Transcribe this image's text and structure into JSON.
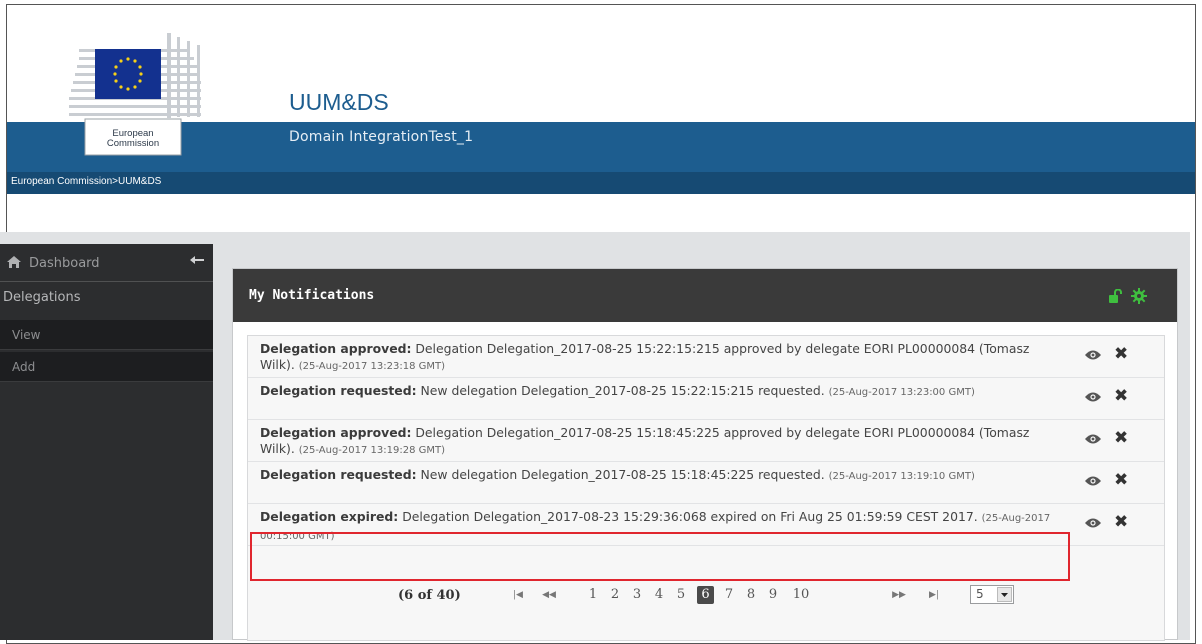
{
  "header": {
    "logo_text_line1": "European",
    "logo_text_line2": "Commission",
    "app_title": "UUM&DS",
    "domain": "Domain IntegrationTest_1"
  },
  "breadcrumb": {
    "items": [
      "European Commission",
      "UUM&DS"
    ],
    "separator": ">"
  },
  "sidebar": {
    "dashboard_label": "Dashboard",
    "section_label": "Delegations",
    "items": [
      {
        "label": "View"
      },
      {
        "label": "Add"
      }
    ]
  },
  "panel": {
    "title": "My Notifications",
    "notifications": [
      {
        "title": "Delegation approved:",
        "message": "Delegation Delegation_2017-08-25 15:22:15:215 approved by delegate EORI PL00000084 (Tomasz Wilk).",
        "timestamp": "(25-Aug-2017 13:23:18 GMT)"
      },
      {
        "title": "Delegation requested:",
        "message": "New delegation Delegation_2017-08-25 15:22:15:215 requested.",
        "timestamp": "(25-Aug-2017 13:23:00 GMT)"
      },
      {
        "title": "Delegation approved:",
        "message": "Delegation Delegation_2017-08-25 15:18:45:225 approved by delegate EORI PL00000084 (Tomasz Wilk).",
        "timestamp": "(25-Aug-2017 13:19:28 GMT)"
      },
      {
        "title": "Delegation requested:",
        "message": "New delegation Delegation_2017-08-25 15:18:45:225 requested.",
        "timestamp": "(25-Aug-2017 13:19:10 GMT)"
      },
      {
        "title": "Delegation expired:",
        "message": "Delegation Delegation_2017-08-23 15:29:36:068 expired on Fri Aug 25 01:59:59 CEST 2017.",
        "timestamp": "(25-Aug-2017 00:15:00 GMT)",
        "highlighted": true
      }
    ]
  },
  "pagination": {
    "summary": "(6 of 40)",
    "first": "◀◀",
    "prev": "◀◀",
    "pages": [
      "1",
      "2",
      "3",
      "4",
      "5",
      "6",
      "7",
      "8",
      "9",
      "10"
    ],
    "current_page": "6",
    "next": "▶▶",
    "last": "▶▶",
    "rows_per_page": "5"
  },
  "colors": {
    "header_blue": "#1d5d8f",
    "breadcrumb_bar": "#164a73",
    "sidebar_bg": "#2c2d2f",
    "panel_header": "#3a3a3a",
    "lock_gear_green": "#3fbf3f",
    "highlight_red": "#e0262e"
  }
}
